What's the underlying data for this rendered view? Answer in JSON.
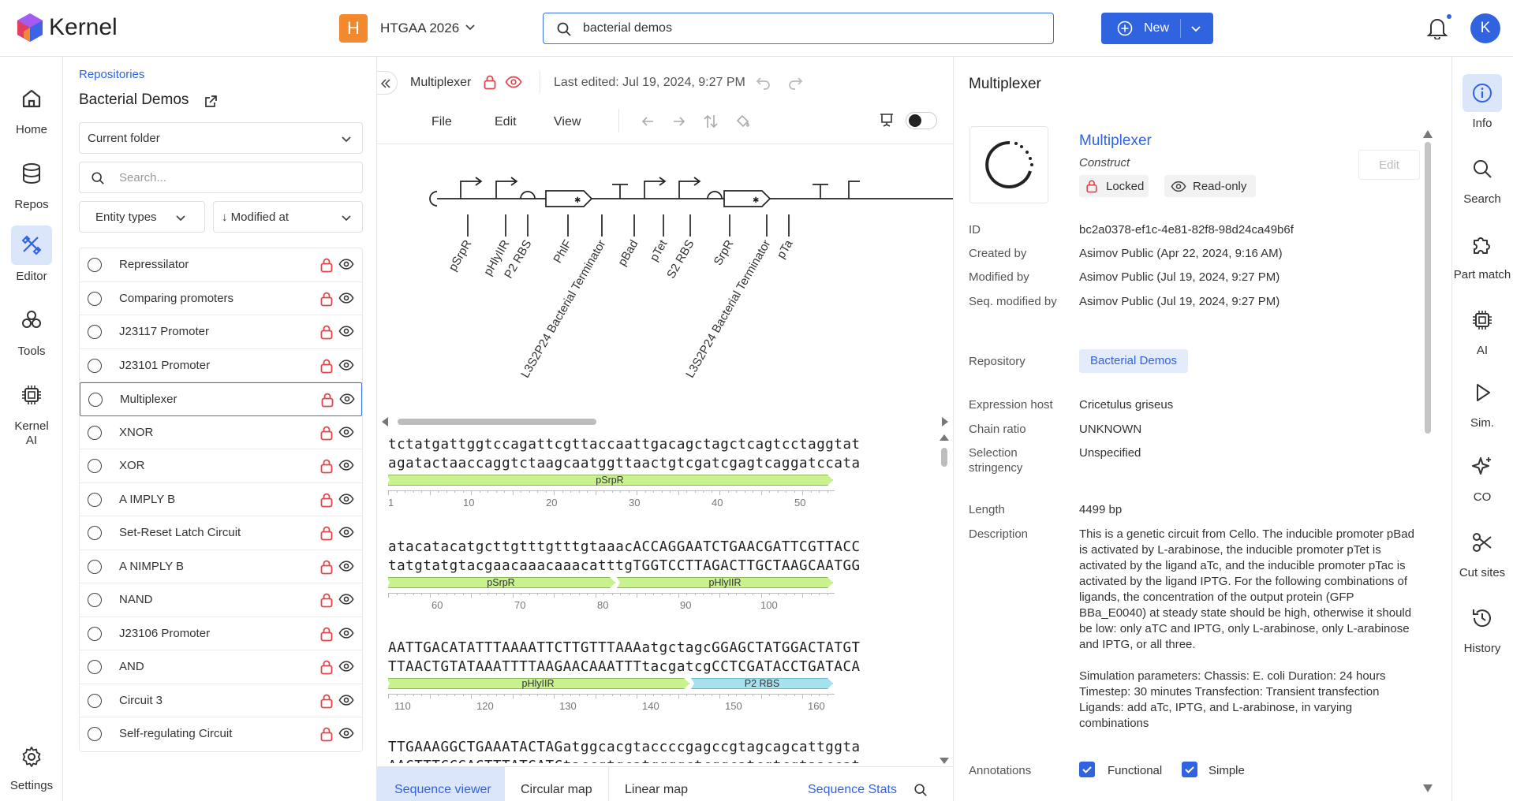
{
  "app": {
    "name": "Kernel"
  },
  "topbar": {
    "workspace_letter": "H",
    "workspace_name": "HTGAA 2026",
    "search_value": "bacterial demos",
    "new_label": "New",
    "avatar_letter": "K"
  },
  "leftnav": {
    "items": [
      {
        "label": "Home",
        "icon": "home-icon"
      },
      {
        "label": "Repos",
        "icon": "database-icon"
      },
      {
        "label": "Editor",
        "icon": "editor-icon",
        "active": true
      },
      {
        "label": "Tools",
        "icon": "tools-icon"
      },
      {
        "label": "Kernel AI",
        "icon": "chip-icon"
      }
    ],
    "settings_label": "Settings"
  },
  "filepanel": {
    "breadcrumb": "Repositories",
    "title": "Bacterial Demos",
    "folder_select": "Current folder",
    "search_placeholder": "Search...",
    "entity_filter": "Entity types",
    "sort_filter": "↓ Modified at",
    "items": [
      "Repressilator",
      "Comparing promoters",
      "J23117 Promoter",
      "J23101 Promoter",
      "Multiplexer",
      "XNOR",
      "XOR",
      "A IMPLY B",
      "Set-Reset Latch Circuit",
      "A NIMPLY B",
      "NAND",
      "J23106 Promoter",
      "AND",
      "Circuit 3",
      "Self-regulating Circuit"
    ],
    "selected_index": 4
  },
  "editor": {
    "doc_name": "Multiplexer",
    "last_edited": "Last edited: Jul 19, 2024, 9:27 PM",
    "menu": [
      "File",
      "Edit",
      "View"
    ],
    "glyph_labels": [
      "pSrpR",
      "pHlyIIR",
      "P2 RBS",
      "PhlF",
      "L3S2P24 Bacterial Terminator",
      "pBad",
      "pTet",
      "S2 RBS",
      "SrpR",
      "L3S2P24 Bacterial Terminator",
      "pTa"
    ],
    "sequence_blocks": [
      {
        "top": "tctatgattggtccagattcgttaccaattgacagctagctcagtcctaggtat",
        "bottom": "agatactaaccaggtctaagcaatggttaactgtcgatcgagtcaggatccata",
        "features": [
          {
            "label": "pSrpR",
            "color": "#c7f28e"
          }
        ],
        "ticks": [
          "1",
          "10",
          "20",
          "30",
          "40",
          "50"
        ]
      },
      {
        "top": "atacatacatgcttgtttgtttgtaaacACCAGGAATCTGAACGATTCGTTACC",
        "bottom": "tatgtatgtacgaacaaacaaacatttgTGGTCCTTAGACTTGCTAAGCAATGG",
        "features": [
          {
            "label": "pSrpR",
            "color": "#c7f28e"
          },
          {
            "label": "pHlyIIR",
            "color": "#c7f28e"
          }
        ],
        "ticks": [
          "60",
          "70",
          "80",
          "90",
          "100"
        ]
      },
      {
        "top": "AATTGACATATTTAAAATTCTTGTTTAAAatgctagcGGAGCTATGGACTATGT",
        "bottom": "TTAACTGTATAAATTTTAAGAACAAATTTtacgatcgCCTCGATACCTGATACA",
        "features": [
          {
            "label": "pHlyIIR",
            "color": "#c7f28e"
          },
          {
            "label": "P2 RBS",
            "color": "#a6e1ee"
          }
        ],
        "ticks": [
          "110",
          "120",
          "130",
          "140",
          "150",
          "160"
        ]
      },
      {
        "top": "TTGAAAGGCTGAAATACTAGatggcacgtaccccgagccgtagcagcattggta",
        "bottom": "AACTTTCCGACTTTATGATCtaccgtgcatggggctcggcatcgtcgtaaccat"
      }
    ],
    "bottom_tabs": [
      "Sequence viewer",
      "Circular map",
      "Linear map"
    ],
    "stats_link": "Sequence Stats"
  },
  "info": {
    "title": "Multiplexer",
    "name": "Multiplexer",
    "type": "Construct",
    "locked_label": "Locked",
    "readonly_label": "Read-only",
    "edit_label": "Edit",
    "fields": {
      "id_k": "ID",
      "id_v": "bc2a0378-ef1c-4e81-82f8-98d24ca49b6f",
      "created_k": "Created by",
      "created_v": "Asimov Public (Apr 22, 2024, 9:16 AM)",
      "modified_k": "Modified by",
      "modified_v": "Asimov Public (Jul 19, 2024, 9:27 PM)",
      "seqmod_k": "Seq. modified by",
      "seqmod_v": "Asimov Public (Jul 19, 2024, 9:27 PM)",
      "repo_k": "Repository",
      "repo_v": "Bacterial Demos",
      "host_k": "Expression host",
      "host_v": "Cricetulus griseus",
      "chain_k": "Chain ratio",
      "chain_v": "UNKNOWN",
      "strin_k": "Selection stringency",
      "strin_v": "Unspecified",
      "len_k": "Length",
      "len_v": "4499 bp",
      "desc_k": "Description",
      "desc_v": "This is a genetic circuit from Cello. The inducible promoter pBad is activated by L-arabinose, the inducible promoter pTet is activated by the ligand aTc, and the inducible promoter pTac is activated by the ligand IPTG. For the following combinations of ligands, the concentration of the output protein (GFP BBa_E0040) at steady state should be high, otherwise it should be low: only aTC and IPTG, only L-arabinose, only L-arabinose and IPTG, or all three.",
      "sim_v": "Simulation parameters: Chassis: E. coli Duration: 24 hours Timestep: 30 minutes Transfection: Transient transfection Ligands: add aTc, IPTG, and L-arabinose, in varying combinations",
      "ann_k": "Annotations",
      "ann_1": "Functional",
      "ann_2": "Simple"
    }
  },
  "rightrail": {
    "items": [
      {
        "label": "Info",
        "icon": "info-icon",
        "active": true
      },
      {
        "label": "Search",
        "icon": "search-icon"
      },
      {
        "label": "Part match",
        "icon": "puzzle-icon"
      },
      {
        "label": "AI",
        "icon": "chip-icon"
      },
      {
        "label": "Sim.",
        "icon": "play-icon"
      },
      {
        "label": "CO",
        "icon": "sparkle-icon"
      },
      {
        "label": "Cut sites",
        "icon": "scissors-icon"
      },
      {
        "label": "History",
        "icon": "history-icon"
      }
    ]
  },
  "colors": {
    "accent": "#2f63e0",
    "lock": "#e0464b",
    "orange": "#f28a2d",
    "feature_green": "#c7f28e",
    "feature_blue": "#a6e1ee"
  }
}
